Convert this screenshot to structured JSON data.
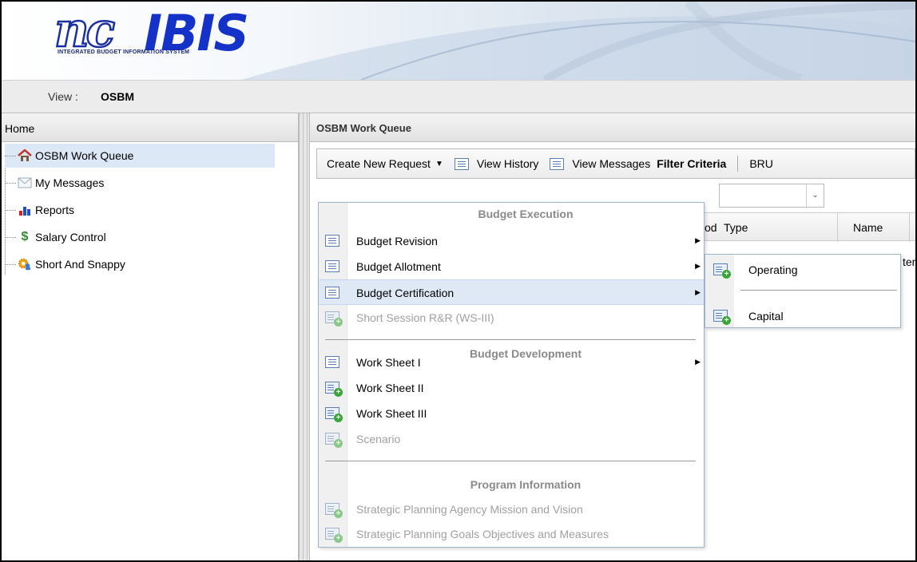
{
  "banner": {
    "logo_nc": "nc",
    "logo_ibis": "IBIS",
    "logo_subtitle": "INTEGRATED BUDGET INFORMATION SYSTEM"
  },
  "viewbar": {
    "label": "View :",
    "value": "OSBM"
  },
  "left": {
    "title": "Home",
    "items": [
      {
        "label": "OSBM Work Queue",
        "icon": "home-icon",
        "selected": true
      },
      {
        "label": "My Messages",
        "icon": "envelope-icon"
      },
      {
        "label": "Reports",
        "icon": "bar-chart-icon"
      },
      {
        "label": "Salary Control",
        "icon": "dollar-icon"
      },
      {
        "label": "Short And Snappy",
        "icon": "gear-people-icon"
      }
    ]
  },
  "right": {
    "title": "OSBM Work Queue",
    "toolbar": {
      "create_new_request": "Create New Request",
      "view_history": "View History",
      "view_messages": "View Messages",
      "filter_criteria": "Filter Criteria",
      "bru": "BRU"
    },
    "grid": {
      "col_period_partial": "od",
      "col_type": "Type",
      "col_name": "Name",
      "row_fragment": "tem"
    }
  },
  "menu": {
    "sections": [
      {
        "heading": "Budget Execution",
        "items": [
          {
            "label": "Budget Revision",
            "icon": "list-icon",
            "submenu": true
          },
          {
            "label": "Budget Allotment",
            "icon": "list-icon",
            "submenu": true
          },
          {
            "label": "Budget Certification",
            "icon": "list-icon",
            "submenu": true,
            "highlighted": true
          },
          {
            "label": "Short Session R&R (WS-III)",
            "icon": "add-list-icon",
            "disabled": true
          }
        ]
      },
      {
        "heading": "Budget Development",
        "items": [
          {
            "label": "Work Sheet I",
            "icon": "list-icon",
            "submenu": true
          },
          {
            "label": "Work Sheet II",
            "icon": "add-list-icon"
          },
          {
            "label": "Work Sheet III",
            "icon": "add-list-icon"
          },
          {
            "label": "Scenario",
            "icon": "add-list-icon",
            "disabled": true
          }
        ]
      },
      {
        "heading": "Program Information",
        "items": [
          {
            "label": "Strategic Planning Agency Mission and Vision",
            "icon": "add-list-icon",
            "disabled": true
          },
          {
            "label": "Strategic Planning Goals Objectives and Measures",
            "icon": "add-list-icon",
            "disabled": true
          }
        ]
      }
    ]
  },
  "submenu": {
    "items": [
      {
        "label": "Operating",
        "icon": "add-list-icon"
      },
      {
        "label": "Capital",
        "icon": "add-list-icon"
      }
    ]
  }
}
